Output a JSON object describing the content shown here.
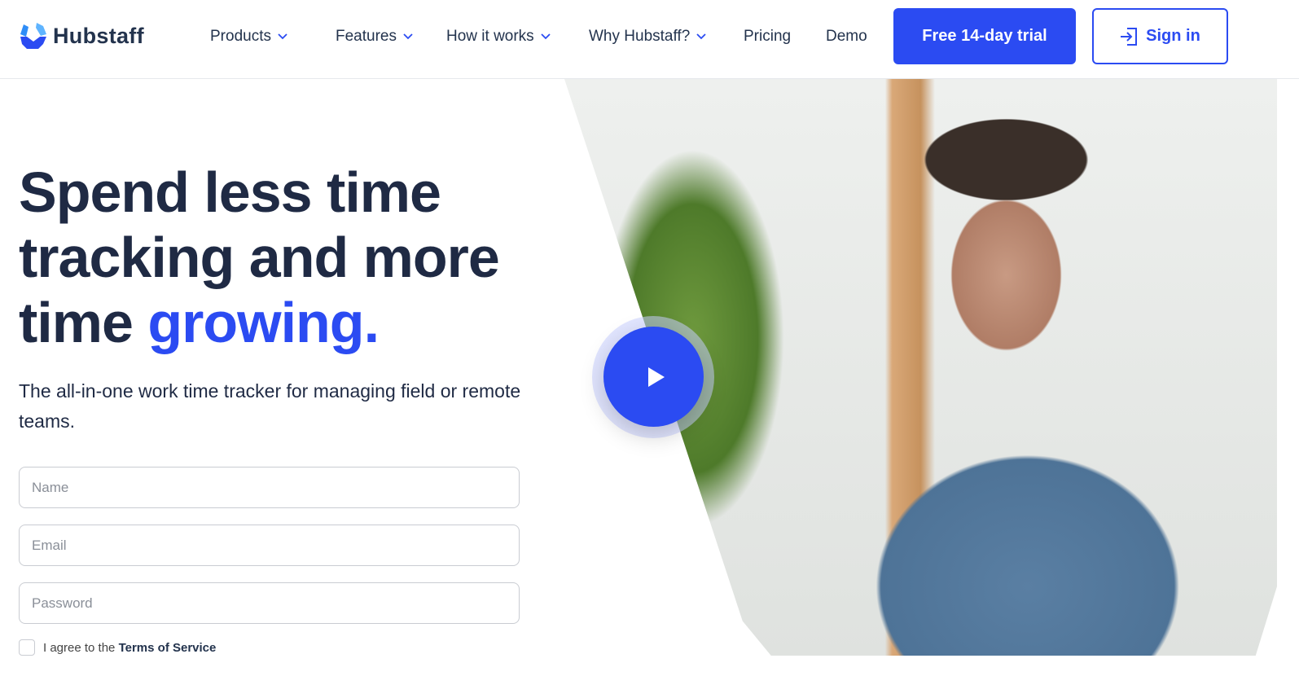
{
  "nav": {
    "brand": "Hubstaff",
    "items": [
      {
        "label": "Products",
        "dropdown": true
      },
      {
        "label": "Features",
        "dropdown": true
      },
      {
        "label": "How it works",
        "dropdown": true
      },
      {
        "label": "Why Hubstaff?",
        "dropdown": true
      },
      {
        "label": "Pricing",
        "dropdown": false
      },
      {
        "label": "Demo",
        "dropdown": false
      }
    ],
    "trial_label": "Free 14-day trial",
    "signin_label": "Sign in",
    "accent": "#2b4bf2"
  },
  "hero": {
    "title_line1": "Spend less time",
    "title_line2": "tracking and more",
    "title_line3": "time ",
    "title_accent": "growing.",
    "subtitle": "The all-in-one work time tracker for managing field or remote teams."
  },
  "form": {
    "name_placeholder": "Name",
    "email_placeholder": "Email",
    "password_placeholder": "Password",
    "agree_text": "I agree to the ",
    "terms_link": "Terms of Service"
  }
}
